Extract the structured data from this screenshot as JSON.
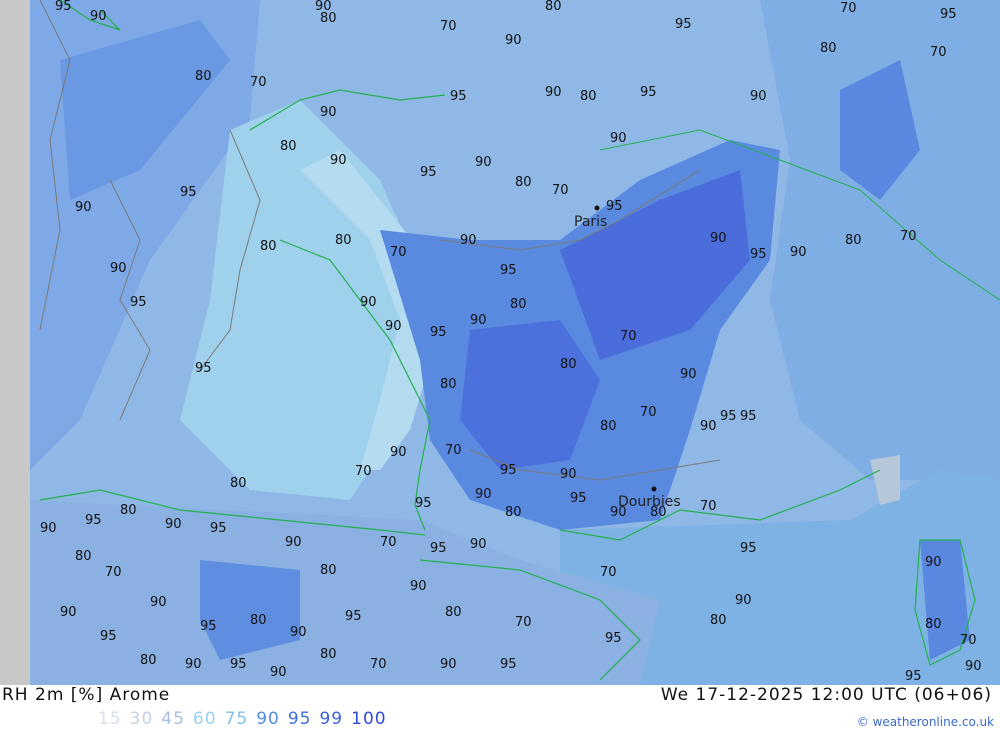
{
  "title": "RH 2m [%] Arome",
  "datetime": "We 17-12-2025 12:00 UTC (06+06)",
  "credit": "© weatheronline.co.uk",
  "legend": [
    {
      "value": "15",
      "color": "#d7ddea"
    },
    {
      "value": "30",
      "color": "#c4d0e6"
    },
    {
      "value": "45",
      "color": "#a9bde3"
    },
    {
      "value": "60",
      "color": "#9ad0f0"
    },
    {
      "value": "75",
      "color": "#7fbfe8"
    },
    {
      "value": "90",
      "color": "#4f8ee0"
    },
    {
      "value": "95",
      "color": "#3f6fe0"
    },
    {
      "value": "99",
      "color": "#3d5fe0"
    },
    {
      "value": "100",
      "color": "#2f4ad8"
    }
  ],
  "cities": [
    "Paris",
    "Dourbies"
  ],
  "contour_labels": [
    "95",
    "90",
    "80",
    "70",
    "95",
    "90",
    "80",
    "70",
    "90",
    "95",
    "80",
    "70",
    "90",
    "95",
    "90",
    "80",
    "95",
    "90",
    "80",
    "70",
    "90",
    "95",
    "80",
    "90",
    "95",
    "90",
    "80",
    "70",
    "95",
    "90",
    "80",
    "70",
    "90",
    "95",
    "80",
    "90",
    "95",
    "90",
    "80",
    "70",
    "90",
    "95",
    "80",
    "90",
    "95",
    "90",
    "80",
    "70",
    "90",
    "95"
  ],
  "colors": {
    "sea_light": "#a6cde6",
    "land_base": "#8ab5e3",
    "humid": "#5d8fe0",
    "very_humid": "#4b72dc",
    "coast": "#22b14c",
    "contour": "#808080",
    "left_strip": "#c8c8c8"
  }
}
